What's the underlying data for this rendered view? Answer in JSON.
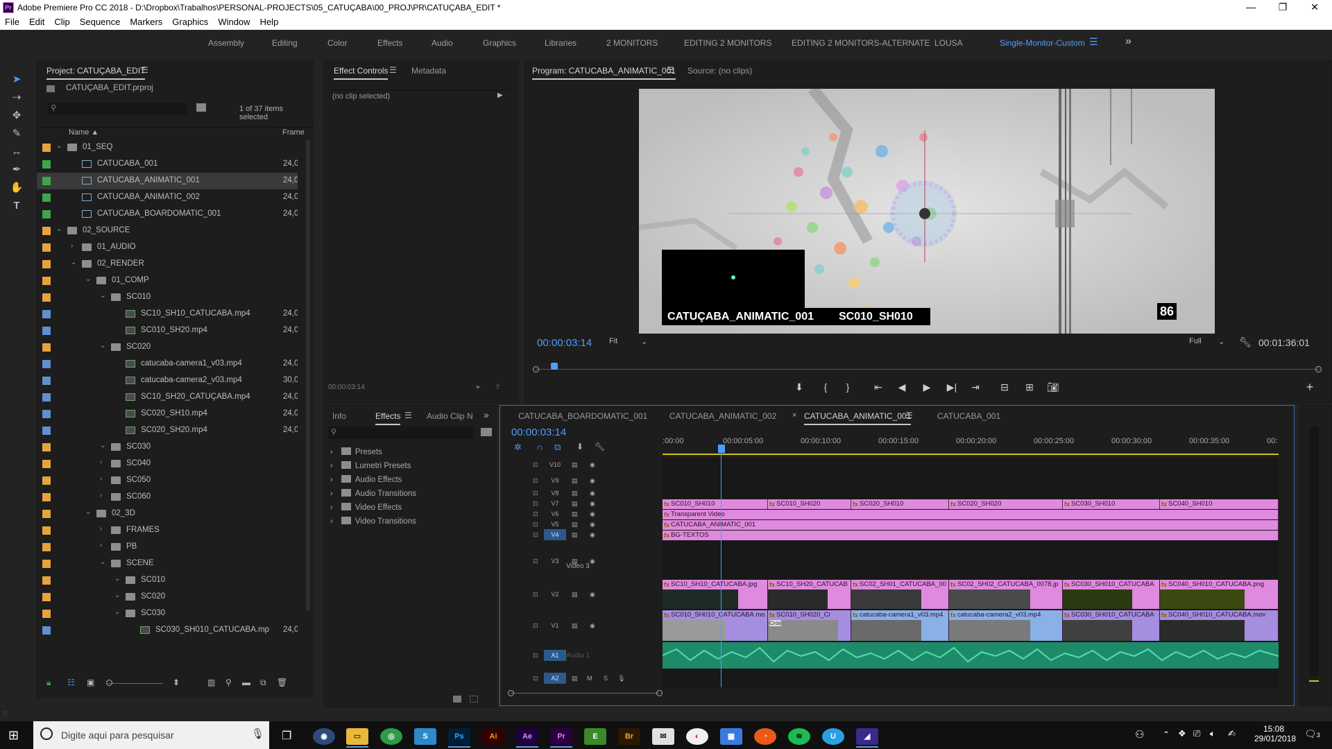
{
  "titlebar": {
    "icon": "Pr",
    "title": "Adobe Premiere Pro CC 2018 - D:\\Dropbox\\Trabalhos\\PERSONAL-PROJECTS\\05_CATUÇABA\\00_PROJ\\PR\\CATUÇABA_EDIT *"
  },
  "menu": [
    "File",
    "Edit",
    "Clip",
    "Sequence",
    "Markers",
    "Graphics",
    "Window",
    "Help"
  ],
  "workspaces": {
    "items": [
      "Assembly",
      "Editing",
      "Color",
      "Effects",
      "Audio",
      "Graphics",
      "Libraries",
      "2 MONITORS",
      "EDITING 2 MONITORS",
      "EDITING 2 MONITORS-ALTERNATE",
      "LOUSA",
      "Single-Monitor-Custom"
    ],
    "active": "Single-Monitor-Custom",
    "more": "»"
  },
  "project": {
    "tab": "Project: CATUÇABA_EDIT",
    "file": "CATUÇABA_EDIT.prproj",
    "search_placeholder": "",
    "items_selected": "1 of 37 items selected",
    "col_name": "Name",
    "col_frame": "Frame",
    "rows": [
      {
        "name": "01_SEQ",
        "type": "folder",
        "color": "#e8a33c",
        "indent": 0,
        "twirl": "v",
        "frame": ""
      },
      {
        "name": "CATUCABA_001",
        "type": "seq",
        "color": "#3ea54a",
        "indent": 1,
        "twirl": "",
        "frame": "24,0"
      },
      {
        "name": "CATUCABA_ANIMATIC_001",
        "type": "seq",
        "color": "#3ea54a",
        "indent": 1,
        "twirl": "",
        "frame": "24,0",
        "selected": true
      },
      {
        "name": "CATUCABA_ANIMATIC_002",
        "type": "seq",
        "color": "#3ea54a",
        "indent": 1,
        "twirl": "",
        "frame": "24,0"
      },
      {
        "name": "CATUCABA_BOARDOMATIC_001",
        "type": "seq",
        "color": "#3ea54a",
        "indent": 1,
        "twirl": "",
        "frame": "24,0"
      },
      {
        "name": "02_SOURCE",
        "type": "folder",
        "color": "#e8a33c",
        "indent": 0,
        "twirl": "v",
        "frame": ""
      },
      {
        "name": "01_AUDIO",
        "type": "folder",
        "color": "#e8a33c",
        "indent": 1,
        "twirl": ">",
        "frame": ""
      },
      {
        "name": "02_RENDER",
        "type": "folder",
        "color": "#e8a33c",
        "indent": 1,
        "twirl": "v",
        "frame": ""
      },
      {
        "name": "01_COMP",
        "type": "folder",
        "color": "#e8a33c",
        "indent": 2,
        "twirl": "v",
        "frame": ""
      },
      {
        "name": "SC010",
        "type": "folder",
        "color": "#e8a33c",
        "indent": 3,
        "twirl": "v",
        "frame": ""
      },
      {
        "name": "SC10_SH10_CATUCABA.mp4",
        "type": "clip",
        "color": "#5f8fd0",
        "indent": 4,
        "twirl": "",
        "frame": "24,0"
      },
      {
        "name": "SC010_SH20.mp4",
        "type": "clip",
        "color": "#5f8fd0",
        "indent": 4,
        "twirl": "",
        "frame": "24,0"
      },
      {
        "name": "SC020",
        "type": "folder",
        "color": "#e8a33c",
        "indent": 3,
        "twirl": "v",
        "frame": ""
      },
      {
        "name": "catucaba-camera1_v03.mp4",
        "type": "clip",
        "color": "#5f8fd0",
        "indent": 4,
        "twirl": "",
        "frame": "24,0"
      },
      {
        "name": "catucaba-camera2_v03.mp4",
        "type": "clip",
        "color": "#5f8fd0",
        "indent": 4,
        "twirl": "",
        "frame": "30,0"
      },
      {
        "name": "SC10_SH20_CATUÇABA.mp4",
        "type": "clip",
        "color": "#5f8fd0",
        "indent": 4,
        "twirl": "",
        "frame": "24,0"
      },
      {
        "name": "SC020_SH10.mp4",
        "type": "clip",
        "color": "#5f8fd0",
        "indent": 4,
        "twirl": "",
        "frame": "24,0"
      },
      {
        "name": "SC020_SH20.mp4",
        "type": "clip",
        "color": "#5f8fd0",
        "indent": 4,
        "twirl": "",
        "frame": "24,0"
      },
      {
        "name": "SC030",
        "type": "folder",
        "color": "#e8a33c",
        "indent": 3,
        "twirl": "v",
        "frame": ""
      },
      {
        "name": "SC040",
        "type": "folder",
        "color": "#e8a33c",
        "indent": 3,
        "twirl": ">",
        "frame": ""
      },
      {
        "name": "SC050",
        "type": "folder",
        "color": "#e8a33c",
        "indent": 3,
        "twirl": ">",
        "frame": ""
      },
      {
        "name": "SC060",
        "type": "folder",
        "color": "#e8a33c",
        "indent": 3,
        "twirl": ">",
        "frame": ""
      },
      {
        "name": "02_3D",
        "type": "folder",
        "color": "#e8a33c",
        "indent": 2,
        "twirl": "v",
        "frame": ""
      },
      {
        "name": "FRAMES",
        "type": "folder",
        "color": "#e8a33c",
        "indent": 3,
        "twirl": ">",
        "frame": ""
      },
      {
        "name": "PB",
        "type": "folder",
        "color": "#e8a33c",
        "indent": 3,
        "twirl": ">",
        "frame": ""
      },
      {
        "name": "SCENE",
        "type": "folder",
        "color": "#e8a33c",
        "indent": 3,
        "twirl": "v",
        "frame": ""
      },
      {
        "name": "SC010",
        "type": "folder",
        "color": "#e8a33c",
        "indent": 4,
        "twirl": "v",
        "frame": ""
      },
      {
        "name": "SC020",
        "type": "folder",
        "color": "#e8a33c",
        "indent": 4,
        "twirl": "v",
        "frame": ""
      },
      {
        "name": "SC030",
        "type": "folder",
        "color": "#e8a33c",
        "indent": 4,
        "twirl": "v",
        "frame": ""
      },
      {
        "name": "SC030_SH010_CATUCABA.mp",
        "type": "clip",
        "color": "#5f8fd0",
        "indent": 5,
        "twirl": "",
        "frame": "24,0"
      },
      {
        "name": "SC040",
        "type": "folder",
        "color": "#e8a33c",
        "indent": 4,
        "twirl": "v",
        "frame": ""
      },
      {
        "name": "SC050",
        "type": "folder",
        "color": "#e8a33c",
        "indent": 4,
        "twirl": "v",
        "frame": ""
      }
    ]
  },
  "effect_controls": {
    "tab": "Effect Controls",
    "tab2": "Metadata",
    "no_clip": "(no clip selected)",
    "timecode": "00:00:03:14"
  },
  "effects": {
    "tab_info": "Info",
    "tab_effects": "Effects",
    "tab_audio": "Audio Clip N",
    "items": [
      "Presets",
      "Lumetri Presets",
      "Audio Effects",
      "Audio Transitions",
      "Video Effects",
      "Video Transitions"
    ]
  },
  "program": {
    "tab": "Program: CATUCABA_ANIMATIC_001",
    "source_tab": "Source: (no clips)",
    "overlay_seq": "CATUÇABA_ANIMATIC_001",
    "overlay_shot": "SC010_SH010",
    "frame_number": "86",
    "timecode": "00:00:03:14",
    "fit": "Fit",
    "quality": "Full",
    "duration": "00:01:36:01",
    "playhead_fraction": 0.024
  },
  "timeline": {
    "tabs": [
      "CATUCABA_BOARDOMATIC_001",
      "CATUCABA_ANIMATIC_002",
      "CATUCABA_ANIMATIC_001",
      "CATUCABA_001"
    ],
    "active_tab": "CATUCABA_ANIMATIC_001",
    "close_icon": "×",
    "timecode": "00:00:03:14",
    "ruler": [
      ":00:00",
      "00:00:05:00",
      "00:00:10:00",
      "00:00:15:00",
      "00:00:20:00",
      "00:00:25:00",
      "00:00:30:00",
      "00:00:35:00",
      "00:"
    ],
    "tracks": [
      "V10",
      "V9",
      "V8",
      "V7",
      "V6",
      "V5",
      "V4",
      "V3",
      "V2",
      "V1",
      "A1",
      "A2"
    ],
    "v3_name": "Video 3",
    "a1_name": "Audio 1",
    "m_label": "M",
    "s_label": "S",
    "v7_clips": [
      "SC010_SH010",
      "SC010_SH020",
      "SC020_SH010",
      "SC020_SH020",
      "SC030_SH010",
      "SC040_SH010"
    ],
    "v6_clip": "Transparent Video",
    "v5_clip": "CATUCABA_ANIMATIC_001",
    "v4_clip": "BG-TEXTOS",
    "v2_clips": [
      "SC10_SH10_CATUCABA.jpg",
      "SC10_SH20_CATUCAB",
      "SC02_SH01_CATUCABA_00",
      "SC02_SH02_CATUCABA_0078.jp",
      "SC030_SH010_CATUCABA",
      "SC040_SH010_CATUCABA.png"
    ],
    "v1_clips": [
      "SC010_SH010_CATUCABA.mo",
      "SC010_SH020_Ci",
      "catucaba-camera1_v03.mp4",
      "catucaba-camera2_v03.mp4",
      "SC030_SH010_CATUCABA",
      "SC040_SH010_CATUCABA.mov"
    ],
    "v1_cross": "Cros"
  },
  "taskbar": {
    "search_placeholder": "Digite aqui para pesquisar",
    "time": "15:08",
    "date": "29/01/2018",
    "notif_count": "3"
  }
}
